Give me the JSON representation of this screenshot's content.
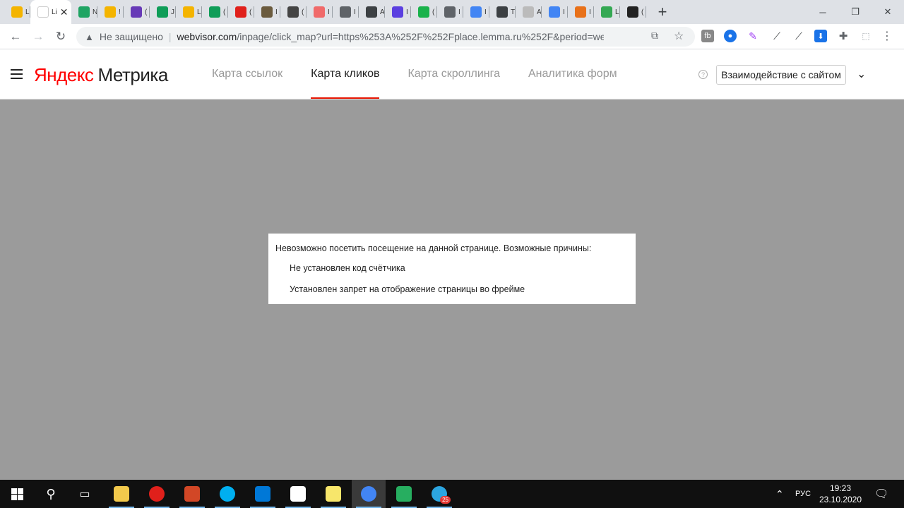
{
  "browser": {
    "tabs": [
      {
        "icon": "metrika-favicon-icon",
        "color": "#f4b400",
        "label": "L"
      },
      {
        "icon": "page-favicon-icon",
        "color": "#ffffff",
        "label": "Li",
        "active": true
      },
      {
        "icon": "google-drive-icon",
        "color": "#1fa463",
        "label": "N"
      },
      {
        "icon": "google-slides-icon",
        "color": "#f4b400",
        "label": "!"
      },
      {
        "icon": "google-forms-icon",
        "color": "#673ab7",
        "label": "("
      },
      {
        "icon": "google-sheets-icon",
        "color": "#0f9d58",
        "label": "J"
      },
      {
        "icon": "google-slides-icon",
        "color": "#f4b400",
        "label": "L"
      },
      {
        "icon": "google-sheets-icon",
        "color": "#0f9d58",
        "label": "("
      },
      {
        "icon": "opera-icon",
        "color": "#e0201b",
        "label": "("
      },
      {
        "icon": "image-icon",
        "color": "#6b5b3e",
        "label": "I"
      },
      {
        "icon": "chat-icon",
        "color": "#444444",
        "label": "("
      },
      {
        "icon": "asana-icon",
        "color": "#f06a6a",
        "label": "I"
      },
      {
        "icon": "globe-icon",
        "color": "#5f6368",
        "label": "I"
      },
      {
        "icon": "draw-icon",
        "color": "#3c4043",
        "label": "A"
      },
      {
        "icon": "s-letter-icon",
        "color": "#5b3fe0",
        "label": "I"
      },
      {
        "icon": "two-circle-icon",
        "color": "#1ab24b",
        "label": "("
      },
      {
        "icon": "globe-icon",
        "color": "#5f6368",
        "label": "I"
      },
      {
        "icon": "google-docs-icon",
        "color": "#4285f4",
        "label": "I"
      },
      {
        "icon": "t-circle-icon",
        "color": "#3c4043",
        "label": "T"
      },
      {
        "icon": "dotted-square-icon",
        "color": "#bbbbbb",
        "label": "A"
      },
      {
        "icon": "google-icon",
        "color": "#4285f4",
        "label": "I"
      },
      {
        "icon": "pixel-icon",
        "color": "#e8711a",
        "label": "I"
      },
      {
        "icon": "maps-pin-icon",
        "color": "#34a853",
        "label": "L"
      },
      {
        "icon": "notion-icon",
        "color": "#222222",
        "label": "("
      }
    ],
    "address": {
      "security_label": "Не защищено",
      "url_host": "webvisor.com",
      "url_path": "/inpage/click_map?url=https%253A%252F%252Fplace.lemma.ru%252F&period=week&id=..."
    }
  },
  "header": {
    "logo_yandex": "Яндекс",
    "logo_metrika": "Метрика",
    "tabs": [
      {
        "label": "Карта ссылок",
        "active": false
      },
      {
        "label": "Карта кликов",
        "active": true
      },
      {
        "label": "Карта скроллинга",
        "active": false
      },
      {
        "label": "Аналитика форм",
        "active": false
      }
    ],
    "help_label": "?",
    "interact_button": "Взаимодействие с сайтом"
  },
  "message": {
    "title": "Невозможно посетить посещение на данной странице. Возможные причины:",
    "reasons": [
      "Не установлен код счётчика",
      "Установлен запрет на отображение страницы во фрейме"
    ]
  },
  "taskbar": {
    "apps": [
      {
        "icon": "file-explorer-icon",
        "color": "#f2c94c"
      },
      {
        "icon": "opera-icon",
        "color": "#e0201b"
      },
      {
        "icon": "powerpoint-icon",
        "color": "#d24726"
      },
      {
        "icon": "skype-icon",
        "color": "#00aff0"
      },
      {
        "icon": "edge-icon",
        "color": "#0078d7"
      },
      {
        "icon": "store-icon",
        "color": "#ffffff"
      },
      {
        "icon": "sticky-notes-icon",
        "color": "#f7e66b"
      },
      {
        "icon": "chrome-icon",
        "color": "#4285f4"
      },
      {
        "icon": "green-pen-app-icon",
        "color": "#27ae60"
      },
      {
        "icon": "telegram-icon",
        "color": "#2ca5e0",
        "badge": "25"
      }
    ],
    "language": "РУС",
    "time": "19:23",
    "date": "23.10.2020"
  }
}
